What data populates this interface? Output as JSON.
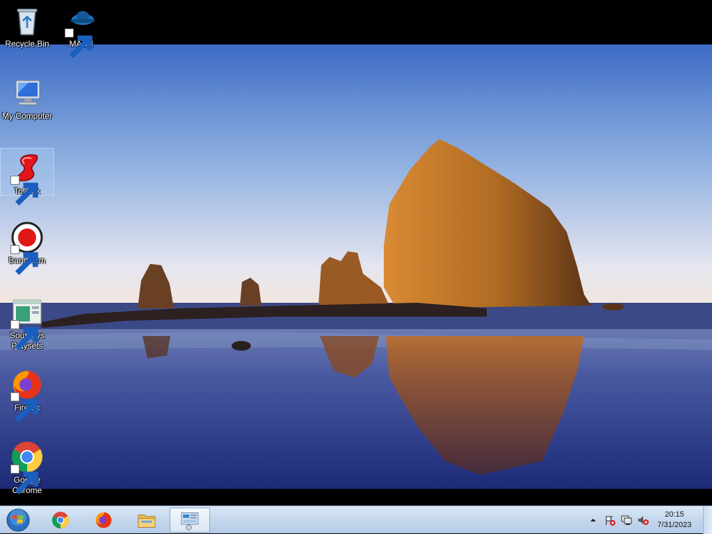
{
  "desktop": {
    "icons": [
      {
        "label": "Recycle Bin",
        "icon": "recycle-bin-icon"
      },
      {
        "label": "MASH",
        "icon": "mash-icon"
      },
      {
        "label": "My Computer",
        "icon": "my-computer-icon"
      },
      {
        "label": "Toybox",
        "icon": "toybox-icon"
      },
      {
        "label": "Bandicam",
        "icon": "bandicam-icon"
      },
      {
        "label": "Souptoys Playsets",
        "icon": "souptoys-icon"
      },
      {
        "label": "Firefox",
        "icon": "firefox-icon"
      },
      {
        "label": "Google Chrome",
        "icon": "chrome-icon"
      }
    ]
  },
  "taskbar": {
    "start_icon": "windows-start-icon",
    "pinned": [
      "chrome-icon",
      "firefox-icon",
      "file-explorer-icon",
      "control-panel-icon"
    ],
    "tray": {
      "time": "20:15",
      "date": "7/31/2023",
      "icons": [
        "show-hidden-icons-chevron",
        "action-center-flag-icon",
        "network-icon",
        "volume-muted-icon"
      ]
    }
  },
  "colors": {
    "taskbar_bg": "#c4d7ed",
    "sky_top": "#3f6fc8",
    "rock": "#b06a22"
  }
}
